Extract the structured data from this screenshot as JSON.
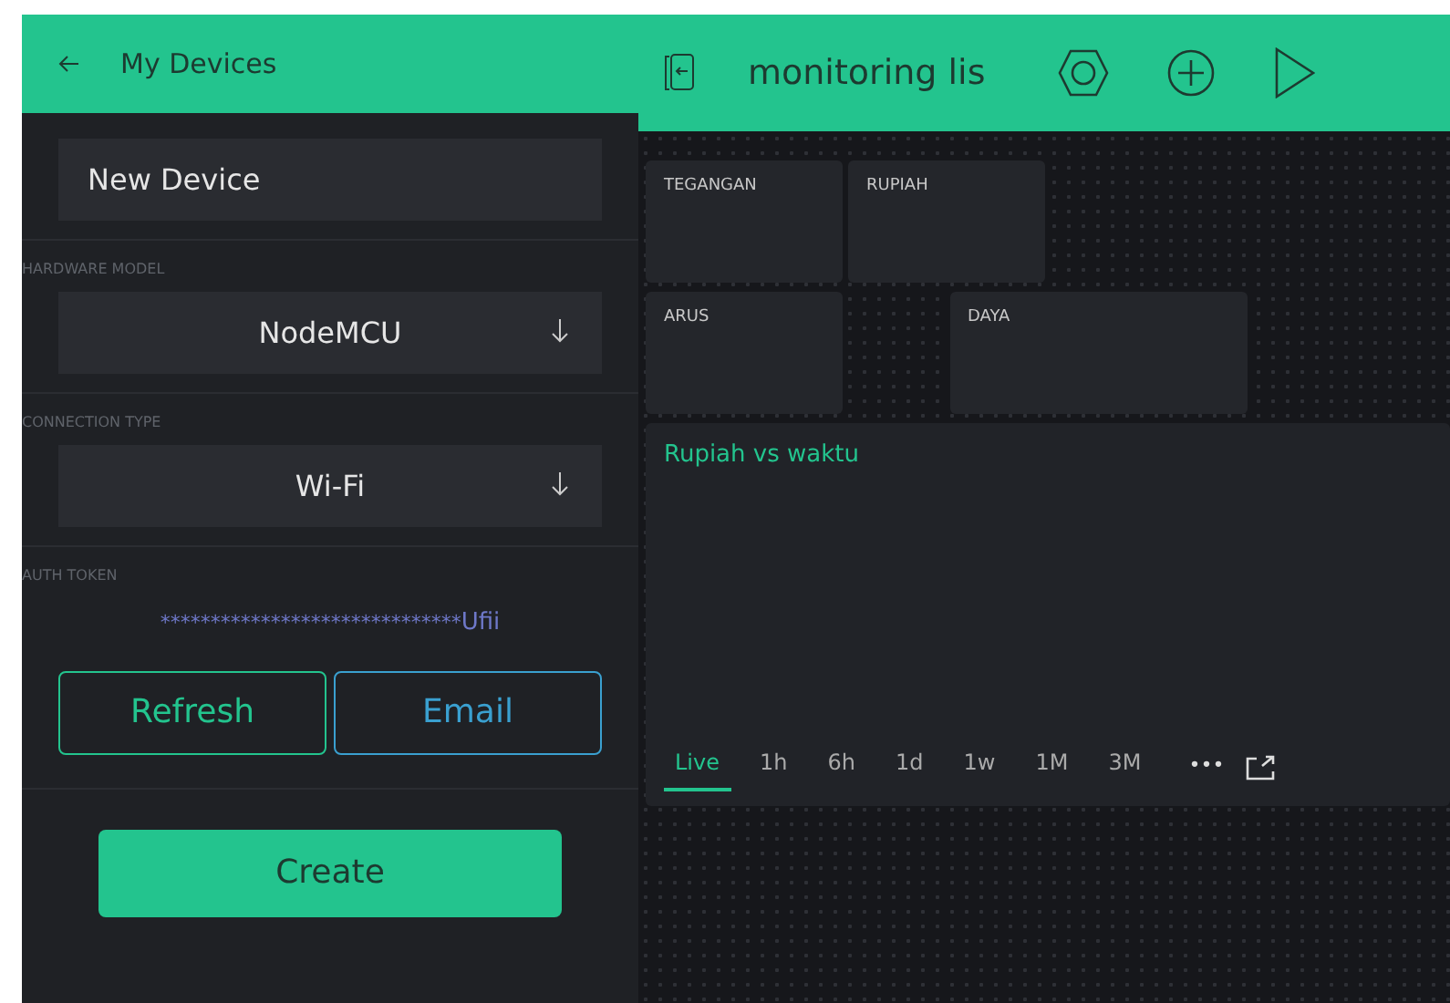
{
  "left_panel": {
    "title": "My Devices",
    "device_name": "New Device",
    "fields": [
      {
        "label": "HARDWARE MODEL",
        "value": "NodeMCU"
      },
      {
        "label": "CONNECTION TYPE",
        "value": "Wi-Fi"
      }
    ],
    "auth_token": {
      "label": "AUTH TOKEN",
      "masked": "******************************",
      "visible": "Ufii"
    },
    "buttons": [
      {
        "label": "Refresh",
        "kind": "refresh"
      },
      {
        "label": "Email",
        "kind": "email"
      }
    ],
    "create_button": "Create"
  },
  "project": {
    "title": "monitoring lis",
    "widgets": [
      {
        "label": "TEGANGAN"
      },
      {
        "label": "RUPIAH"
      },
      {
        "label": "ARUS"
      },
      {
        "label": "DAYA"
      }
    ],
    "chart": {
      "title": "Rupiah vs waktu",
      "ranges": [
        {
          "label": "Live",
          "selected": true
        },
        {
          "label": "1h",
          "selected": false
        },
        {
          "label": "6h",
          "selected": false
        },
        {
          "label": "1d",
          "selected": false
        },
        {
          "label": "1w",
          "selected": false
        },
        {
          "label": "1M",
          "selected": false
        },
        {
          "label": "3M",
          "selected": false
        }
      ],
      "more": "•••"
    }
  }
}
